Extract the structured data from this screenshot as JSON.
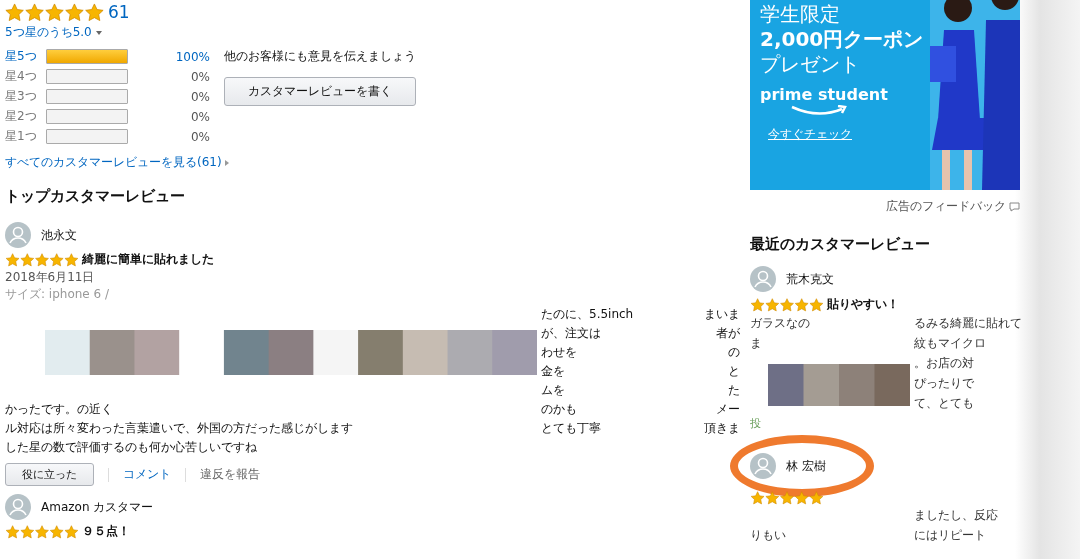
{
  "summary": {
    "stars": 5,
    "count": "61",
    "rating_text": "5つ星のうち5.0",
    "histogram": [
      {
        "label": "星5つ",
        "level": 1,
        "percent": "100%",
        "linked": true
      },
      {
        "label": "星4つ",
        "level": 0,
        "percent": "0%",
        "linked": false
      },
      {
        "label": "星3つ",
        "level": 0,
        "percent": "0%",
        "linked": false
      },
      {
        "label": "星2つ",
        "level": 0,
        "percent": "0%",
        "linked": false
      },
      {
        "label": "星1つ",
        "level": 0,
        "percent": "0%",
        "linked": false
      }
    ],
    "all_reviews_link": "すべてのカスタマーレビューを見る(61)"
  },
  "write_review": {
    "prompt": "他のお客様にも意見を伝えましょう",
    "button": "カスタマーレビューを書く"
  },
  "top_reviews": {
    "heading": "トップカスタマーレビュー",
    "reviews": [
      {
        "author": "池永文",
        "stars": 5,
        "title": "綺麗に簡単に貼れました",
        "date": "2018年6月11日",
        "variant": "サイズ: iphone 6 /",
        "upper_lines": [
          {
            "part_1": "たのに、5.5inch",
            "part_2": "まいま"
          },
          {
            "part_1": "が、注文は",
            "part_2": "者が"
          },
          {
            "part_1": "わせを",
            "part_2": "の"
          },
          {
            "part_1": "金を",
            "part_2": "と"
          },
          {
            "part_1": "ムを",
            "part_2": "た"
          }
        ],
        "lower_lines": [
          {
            "text": "かったです。の近く",
            "part_1": "のかも",
            "part_2": "メー"
          },
          {
            "text": "ル対応は所々変わった言葉遣いで、外国の方だった感じがします",
            "part_1": "とても丁寧",
            "part_2": "頂きま"
          },
          {
            "text": "した星の数で評価するのも何か心苦しいですね"
          }
        ],
        "helpful_button": "役に立った",
        "comment_link": "コメント",
        "report_link": "違反を報告"
      },
      {
        "author": "Amazon カスタマー",
        "stars": 5,
        "title": "９５点！"
      }
    ]
  },
  "ad": {
    "line_1": "学生限定",
    "line_2": "2,000円クーポン",
    "line_3": "プレゼント",
    "brand": "prime student",
    "link": "今すぐチェック",
    "feedback": "広告のフィードバック"
  },
  "recent_reviews": {
    "heading": "最近のカスタマーレビュー",
    "reviews": [
      {
        "author": "荒木克文",
        "stars": 5,
        "title": "貼りやすい！",
        "upper_lines": [
          {
            "left": "ガラスなの",
            "right": "るみる綺麗に貼れて"
          },
          {
            "left": "ま",
            "right": "紋もマイクロ"
          }
        ],
        "lower_lines": [
          {
            "right": "。お店の対"
          },
          {
            "right": "ぴったりで"
          },
          {
            "right": "て、とても"
          }
        ],
        "footer": "投"
      },
      {
        "author": "林 宏樹",
        "stars": 5,
        "highlighted": true,
        "upper_lines": [
          {
            "right": "ましたし、反応"
          },
          {
            "left": "りもい",
            "right": "にはリピート"
          }
        ]
      }
    ]
  }
}
